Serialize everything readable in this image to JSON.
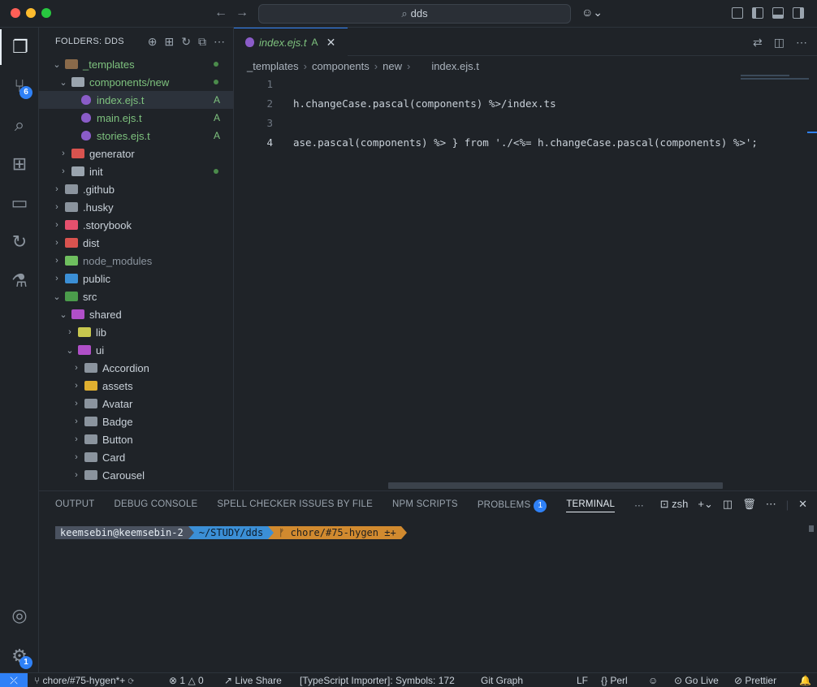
{
  "titlebar": {
    "search_text": "dds"
  },
  "activity": {
    "scm_badge": "6",
    "settings_badge": "1"
  },
  "sidebar": {
    "header": "FOLDERS: DDS",
    "tree": [
      {
        "label": "_templates",
        "depth": 1,
        "chevron": "⌄",
        "color": "#7ec27e",
        "icon": "#8a6a4a",
        "dot": true
      },
      {
        "label": "components/new",
        "depth": 2,
        "chevron": "⌄",
        "color": "#7ec27e",
        "icon": "#9aa4ae",
        "dot": true
      },
      {
        "label": "index.ejs.t",
        "depth": 3,
        "file": true,
        "color": "#7ec27e",
        "status": "A",
        "selected": true
      },
      {
        "label": "main.ejs.t",
        "depth": 3,
        "file": true,
        "color": "#7ec27e",
        "status": "A"
      },
      {
        "label": "stories.ejs.t",
        "depth": 3,
        "file": true,
        "color": "#7ec27e",
        "status": "A"
      },
      {
        "label": "generator",
        "depth": 2,
        "chevron": "›",
        "color": "#c9d1d9",
        "icon": "#d9534f"
      },
      {
        "label": "init",
        "depth": 2,
        "chevron": "›",
        "color": "#c9d1d9",
        "icon": "#9aa4ae",
        "dot": true
      },
      {
        "label": ".github",
        "depth": 1,
        "chevron": "›",
        "color": "#c9d1d9",
        "icon": "#8b949e"
      },
      {
        "label": ".husky",
        "depth": 1,
        "chevron": "›",
        "color": "#c9d1d9",
        "icon": "#8b949e"
      },
      {
        "label": ".storybook",
        "depth": 1,
        "chevron": "›",
        "color": "#c9d1d9",
        "icon": "#e5506d"
      },
      {
        "label": "dist",
        "depth": 1,
        "chevron": "›",
        "color": "#c9d1d9",
        "icon": "#d9534f"
      },
      {
        "label": "node_modules",
        "depth": 1,
        "chevron": "›",
        "color": "#8b949e",
        "icon": "#6fbf5f"
      },
      {
        "label": "public",
        "depth": 1,
        "chevron": "›",
        "color": "#c9d1d9",
        "icon": "#3b8fd6"
      },
      {
        "label": "src",
        "depth": 1,
        "chevron": "⌄",
        "color": "#c9d1d9",
        "icon": "#4b9b4b"
      },
      {
        "label": "shared",
        "depth": 2,
        "chevron": "⌄",
        "color": "#c9d1d9",
        "icon": "#b04fc8"
      },
      {
        "label": "lib",
        "depth": 3,
        "chevron": "›",
        "color": "#c9d1d9",
        "icon": "#c8c84f"
      },
      {
        "label": "ui",
        "depth": 3,
        "chevron": "⌄",
        "color": "#c9d1d9",
        "icon": "#b04fc8"
      },
      {
        "label": "Accordion",
        "depth": 4,
        "chevron": "›",
        "color": "#c9d1d9",
        "icon": "#8b949e"
      },
      {
        "label": "assets",
        "depth": 4,
        "chevron": "›",
        "color": "#c9d1d9",
        "icon": "#e0b030"
      },
      {
        "label": "Avatar",
        "depth": 4,
        "chevron": "›",
        "color": "#c9d1d9",
        "icon": "#8b949e"
      },
      {
        "label": "Badge",
        "depth": 4,
        "chevron": "›",
        "color": "#c9d1d9",
        "icon": "#8b949e"
      },
      {
        "label": "Button",
        "depth": 4,
        "chevron": "›",
        "color": "#c9d1d9",
        "icon": "#8b949e"
      },
      {
        "label": "Card",
        "depth": 4,
        "chevron": "›",
        "color": "#c9d1d9",
        "icon": "#8b949e"
      },
      {
        "label": "Carousel",
        "depth": 4,
        "chevron": "›",
        "color": "#c9d1d9",
        "icon": "#8b949e"
      }
    ]
  },
  "editor": {
    "tab": {
      "label": "index.ejs.t",
      "status": "A"
    },
    "breadcrumb": [
      "_templates",
      "components",
      "new",
      "index.ejs.t"
    ],
    "lines": [
      {
        "num": "1",
        "text": ""
      },
      {
        "num": "2",
        "text": "h.changeCase.pascal(components) %>/index.ts"
      },
      {
        "num": "3",
        "text": ""
      },
      {
        "num": "4",
        "text": "ase.pascal(components) %> } from './<%= h.changeCase.pascal(components) %>';"
      }
    ]
  },
  "panel": {
    "tabs": [
      "OUTPUT",
      "DEBUG CONSOLE",
      "SPELL CHECKER ISSUES BY FILE",
      "NPM SCRIPTS",
      "PROBLEMS",
      "TERMINAL"
    ],
    "problems_count": "1",
    "active_tab": "TERMINAL",
    "shell": "zsh",
    "prompt": {
      "user": "keemsebin@keemsebin-2",
      "dir": "~/STUDY/dds",
      "git": "ᚠ chore/#75-hygen ±+"
    }
  },
  "statusbar": {
    "branch": "chore/#75-hygen*+",
    "errors": "1",
    "warnings": "0",
    "live_share": "Live Share",
    "importer": "[TypeScript Importer]: Symbols: 172",
    "git_graph": "Git Graph",
    "eol": "LF",
    "language": "Perl",
    "go_live": "Go Live",
    "prettier": "Prettier"
  }
}
